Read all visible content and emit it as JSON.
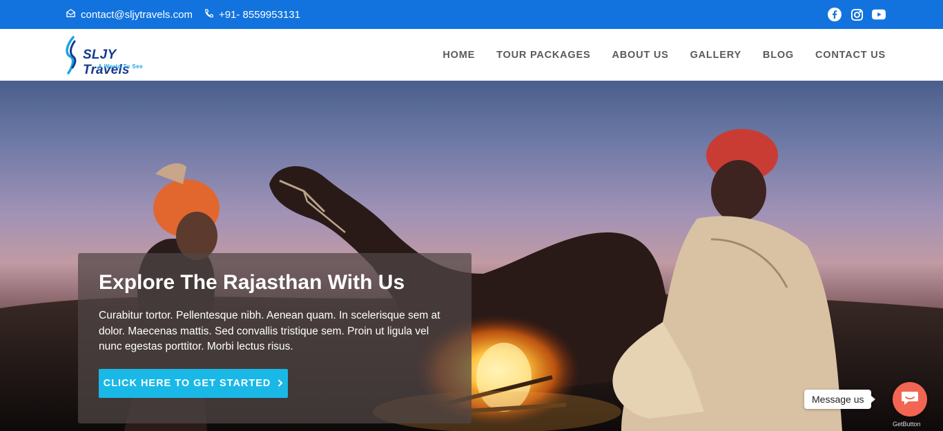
{
  "topbar": {
    "email": "contact@sljytravels.com",
    "phone": "+91- 8559953131",
    "social": [
      "facebook-icon",
      "instagram-icon",
      "youtube-icon"
    ]
  },
  "header": {
    "logo_name": "SLJY Travels",
    "logo_tagline": "A World To See",
    "nav": [
      "HOME",
      "TOUR PACKAGES",
      "ABOUT US",
      "GALLERY",
      "BLOG",
      "CONTACT US"
    ]
  },
  "hero": {
    "title": "Explore The Rajasthan With Us",
    "description": "Curabitur tortor. Pellentesque nibh. Aenean quam. In scelerisque sem at dolor. Maecenas mattis. Sed convallis tristique sem. Proin ut ligula vel nunc egestas porttitor. Morbi lectus risus.",
    "cta_label": "CLICK HERE TO GET STARTED",
    "cta_icon": "chevron-right-icon"
  },
  "chat": {
    "bubble_label": "Message us",
    "powered_by": "GetButton",
    "icon": "chat-icon"
  },
  "colors": {
    "topbar_bg": "#1273de",
    "cta_bg": "#1ab8e6",
    "chat_bg": "#f26552",
    "brand_dark": "#163a8c"
  }
}
